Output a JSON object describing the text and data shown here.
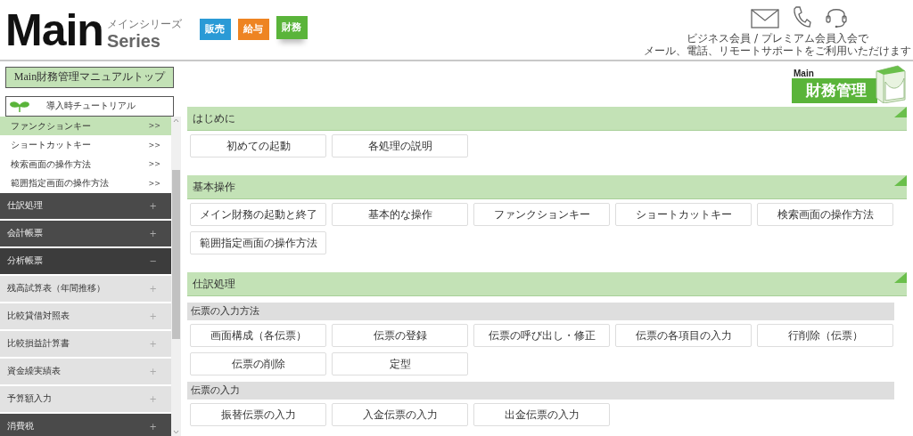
{
  "header": {
    "logo": {
      "main": "Main",
      "kana": "メインシリーズ",
      "series": "Series"
    },
    "products": [
      {
        "label": "販売",
        "color": "#2a9ad6",
        "selected": false
      },
      {
        "label": "給与",
        "color": "#ee8422",
        "selected": false
      },
      {
        "label": "財務",
        "color": "#5ab43a",
        "selected": true
      }
    ],
    "support_text": [
      "ビジネス会員 / プレミアム会員入会で",
      "メール、電話、リモートサポートをご利用いただけます"
    ]
  },
  "sidebar": {
    "top_button": "Main財務管理マニュアルトップ",
    "tutorial_button": "導入時チュートリアル",
    "items": [
      {
        "kind": "sub",
        "label": "ファンクションキー",
        "marker": ">>",
        "selected": true
      },
      {
        "kind": "sub",
        "label": "ショートカットキー",
        "marker": ">>",
        "selected": false
      },
      {
        "kind": "sub",
        "label": "検索画面の操作方法",
        "marker": ">>",
        "selected": false
      },
      {
        "kind": "sub",
        "label": "範囲指定画面の操作方法",
        "marker": ">>",
        "selected": false
      },
      {
        "kind": "category",
        "label": "仕訳処理",
        "toggle": "+",
        "expanded": false
      },
      {
        "kind": "category",
        "label": "会計帳票",
        "toggle": "+",
        "expanded": false
      },
      {
        "kind": "category",
        "label": "分析帳票",
        "toggle": "−",
        "expanded": true
      },
      {
        "kind": "subcategory",
        "label": "残高試算表（年間推移）",
        "toggle": "+",
        "expanded": false
      },
      {
        "kind": "subcategory",
        "label": "比較貸借対照表",
        "toggle": "+",
        "expanded": false
      },
      {
        "kind": "subcategory",
        "label": "比較損益計算書",
        "toggle": "+",
        "expanded": false
      },
      {
        "kind": "subcategory",
        "label": "資金繰実績表",
        "toggle": "+",
        "expanded": false
      },
      {
        "kind": "subcategory",
        "label": "予算額入力",
        "toggle": "+",
        "expanded": false
      },
      {
        "kind": "category",
        "label": "消費税",
        "toggle": "+",
        "expanded": false
      }
    ]
  },
  "product_logo": {
    "brand": "Main",
    "name": "財務管理"
  },
  "sections": [
    {
      "title": "はじめに",
      "groups": [
        {
          "links": [
            "初めての起動",
            "各処理の説明"
          ]
        }
      ]
    },
    {
      "title": "基本操作",
      "groups": [
        {
          "links": [
            "メイン財務の起動と終了",
            "基本的な操作",
            "ファンクションキー",
            "ショートカットキー",
            "検索画面の操作方法",
            "範囲指定画面の操作方法"
          ]
        }
      ]
    },
    {
      "title": "仕訳処理",
      "groups": [
        {
          "title": "伝票の入力方法",
          "links": [
            "画面構成（各伝票）",
            "伝票の登録",
            "伝票の呼び出し・修正",
            "伝票の各項目の入力",
            "行削除（伝票）",
            "伝票の削除",
            "定型"
          ]
        },
        {
          "title": "伝票の入力",
          "links": [
            "振替伝票の入力",
            "入金伝票の入力",
            "出金伝票の入力"
          ]
        }
      ]
    }
  ]
}
